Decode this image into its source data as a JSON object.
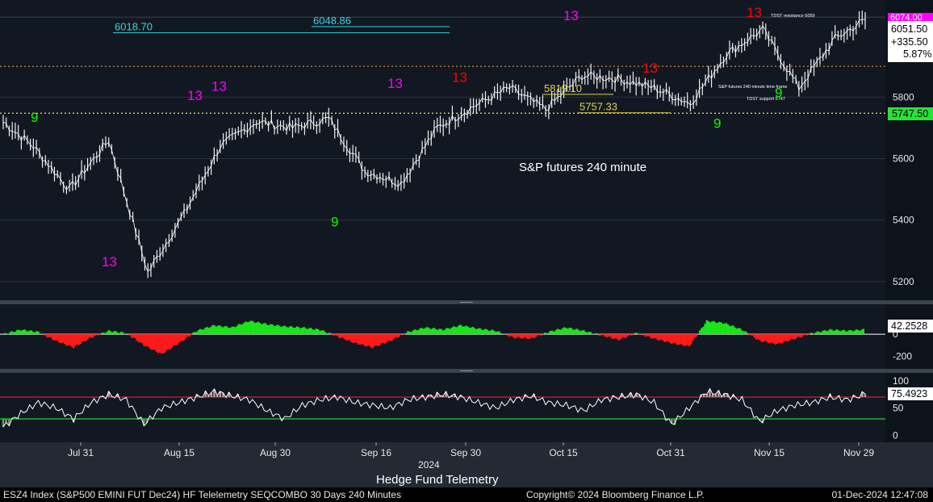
{
  "footer": {
    "left": "ESZ4 Index (S&P500 EMINI FUT  Dec24) HF Telelemetry SEQCOMBO 30 Days 240 Minutes",
    "copyright": "Copyright© 2024 Bloomberg Finance L.P.",
    "timestamp": "01-Dec-2024 12:47:08"
  },
  "chart_data": [
    {
      "panel": "price",
      "type": "line",
      "annotation_text": "S&P futures 240 minute",
      "bottom_label": "Hedge Fund Telemetry",
      "x_tick_labels": [
        "Jul 31",
        "Aug 15",
        "Aug 30",
        "Sep 16",
        "Sep 30",
        "Oct 15",
        "Oct 31",
        "Nov 15",
        "Nov 29"
      ],
      "x_year_label": "2024",
      "y_ticks": [
        5200,
        5400,
        5600,
        5800
      ],
      "ylim": [
        5150,
        6100
      ],
      "last_price": "6051.50",
      "change": "+335.50",
      "change_pct": "5.87%",
      "reference_level": "5747.50",
      "top_marker": "6074.00",
      "colors": {
        "up": "#ffffff",
        "buy": "#00ff00",
        "sell": "#ff0000",
        "thirteen": "#ff00ff",
        "cyan": "#33d6e6",
        "yellow": "#e6d24a"
      },
      "series": [
        {
          "values_index": [
            0,
            10,
            22,
            35,
            48,
            60,
            72,
            84,
            96,
            108,
            120,
            132,
            144,
            156,
            168,
            180,
            192,
            204,
            216,
            228,
            240,
            252,
            264,
            276,
            286
          ],
          "values": [
            5720,
            5640,
            5500,
            5660,
            5230,
            5420,
            5640,
            5720,
            5700,
            5730,
            5560,
            5520,
            5700,
            5770,
            5830,
            5760,
            5870,
            5860,
            5830,
            5780,
            5940,
            6020,
            5830,
            5990,
            6051.5
          ]
        }
      ],
      "levels": [
        {
          "label": "6018.70",
          "value": 6030
        },
        {
          "label": "6048.86",
          "value": 6050
        },
        {
          "label": "5819.10",
          "value": 5830
        },
        {
          "label": "5757.33",
          "value": 5770
        }
      ],
      "notes": [
        "TDST resistance 6059",
        "S&P futures 240 minute time frame",
        "TDST support 5747"
      ],
      "signals": [
        {
          "text": "9",
          "color": "#00ff00",
          "value": 5720
        },
        {
          "text": "13",
          "color": "#ff00ff",
          "value": 5250
        },
        {
          "text": "13",
          "color": "#ff00ff",
          "value": 5790
        },
        {
          "text": "13",
          "color": "#ff00ff",
          "value": 5820
        },
        {
          "text": "13",
          "color": "#ff00ff",
          "value": 5830
        },
        {
          "text": "13",
          "color": "#ff0000",
          "value": 5850
        },
        {
          "text": "13",
          "color": "#ff0000",
          "value": 5880
        },
        {
          "text": "9",
          "color": "#00ff00",
          "value": 5380
        },
        {
          "text": "9",
          "color": "#00ff00",
          "value": 5700
        },
        {
          "text": "9",
          "color": "#00ff00",
          "value": 5800
        },
        {
          "text": "13",
          "color": "#ff0000",
          "value": 6060
        },
        {
          "text": "13",
          "color": "#ff00ff",
          "value": 6050
        }
      ]
    },
    {
      "panel": "momentum",
      "type": "area",
      "last_value": "42.2528",
      "y_ticks": [
        0,
        -200
      ],
      "ylim": [
        -300,
        250
      ],
      "values": [
        0,
        40,
        20,
        -60,
        -120,
        -30,
        30,
        10,
        -100,
        -180,
        -80,
        30,
        80,
        60,
        120,
        90,
        70,
        60,
        40,
        -20,
        -80,
        -120,
        -60,
        20,
        60,
        40,
        80,
        50,
        30,
        -30,
        -40,
        20,
        60,
        30,
        -10,
        -50,
        10,
        -40,
        -80,
        -110,
        120,
        100,
        40,
        -60,
        -90,
        -40,
        10,
        40,
        30,
        42
      ]
    },
    {
      "panel": "oscillator",
      "type": "line",
      "last_value": "75.4923",
      "y_ticks": [
        0,
        50,
        100
      ],
      "ylim": [
        -10,
        110
      ],
      "overbought": 70,
      "oversold": 30,
      "values": [
        15,
        40,
        60,
        50,
        30,
        60,
        75,
        65,
        20,
        50,
        60,
        70,
        80,
        72,
        65,
        45,
        30,
        55,
        65,
        70,
        60,
        55,
        50,
        65,
        70,
        75,
        70,
        60,
        50,
        65,
        72,
        60,
        55,
        45,
        65,
        70,
        75,
        60,
        20,
        50,
        80,
        75,
        65,
        25,
        45,
        55,
        60,
        70,
        65,
        75.5
      ]
    }
  ]
}
